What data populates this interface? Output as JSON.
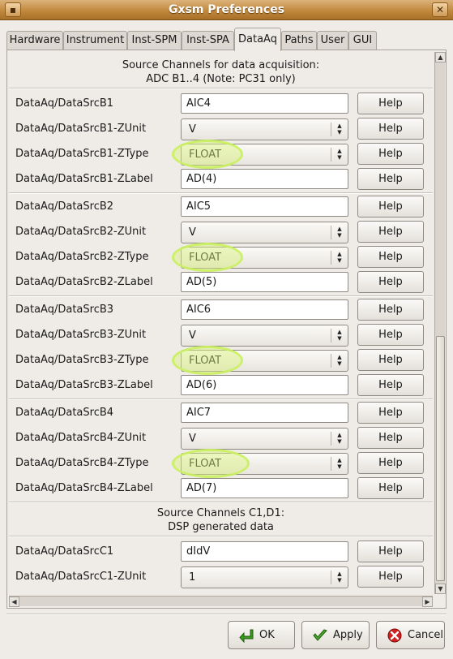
{
  "window": {
    "title": "Gxsm Preferences"
  },
  "tabs": [
    {
      "label": "Hardware"
    },
    {
      "label": "Instrument"
    },
    {
      "label": "Inst-SPM"
    },
    {
      "label": "Inst-SPA"
    },
    {
      "label": "DataAq"
    },
    {
      "label": "Paths"
    },
    {
      "label": "User"
    },
    {
      "label": "GUI"
    }
  ],
  "active_tab": "DataAq",
  "sections": [
    {
      "line1": "Source Channels for data acquisition:",
      "line2": "ADC B1..4 (Note: PC31 only)"
    },
    {
      "line1": "Source Channels C1,D1:",
      "line2": "DSP generated data"
    }
  ],
  "help_label": "Help",
  "rows": [
    {
      "label": "DataAq/DataSrcB1",
      "value": "AIC4"
    },
    {
      "label": "DataAq/DataSrcB1-ZUnit",
      "value": "V"
    },
    {
      "label": "DataAq/DataSrcB1-ZType",
      "value": "FLOAT"
    },
    {
      "label": "DataAq/DataSrcB1-ZLabel",
      "value": "AD(4)"
    },
    {
      "label": "DataAq/DataSrcB2",
      "value": "AIC5"
    },
    {
      "label": "DataAq/DataSrcB2-ZUnit",
      "value": "V"
    },
    {
      "label": "DataAq/DataSrcB2-ZType",
      "value": "FLOAT"
    },
    {
      "label": "DataAq/DataSrcB2-ZLabel",
      "value": "AD(5)"
    },
    {
      "label": "DataAq/DataSrcB3",
      "value": "AIC6"
    },
    {
      "label": "DataAq/DataSrcB3-ZUnit",
      "value": "V"
    },
    {
      "label": "DataAq/DataSrcB3-ZType",
      "value": "FLOAT"
    },
    {
      "label": "DataAq/DataSrcB3-ZLabel",
      "value": "AD(6)"
    },
    {
      "label": "DataAq/DataSrcB4",
      "value": "AIC7"
    },
    {
      "label": "DataAq/DataSrcB4-ZUnit",
      "value": "V"
    },
    {
      "label": "DataAq/DataSrcB4-ZType",
      "value": "FLOAT"
    },
    {
      "label": "DataAq/DataSrcB4-ZLabel",
      "value": "AD(7)"
    },
    {
      "label": "DataAq/DataSrcC1",
      "value": "dIdV"
    },
    {
      "label": "DataAq/DataSrcC1-ZUnit",
      "value": "1"
    }
  ],
  "buttons": {
    "ok": "OK",
    "apply": "Apply",
    "cancel": "Cancel"
  },
  "colors": {
    "highlight": "#d4f07a",
    "titlebar": "#c1893d"
  }
}
